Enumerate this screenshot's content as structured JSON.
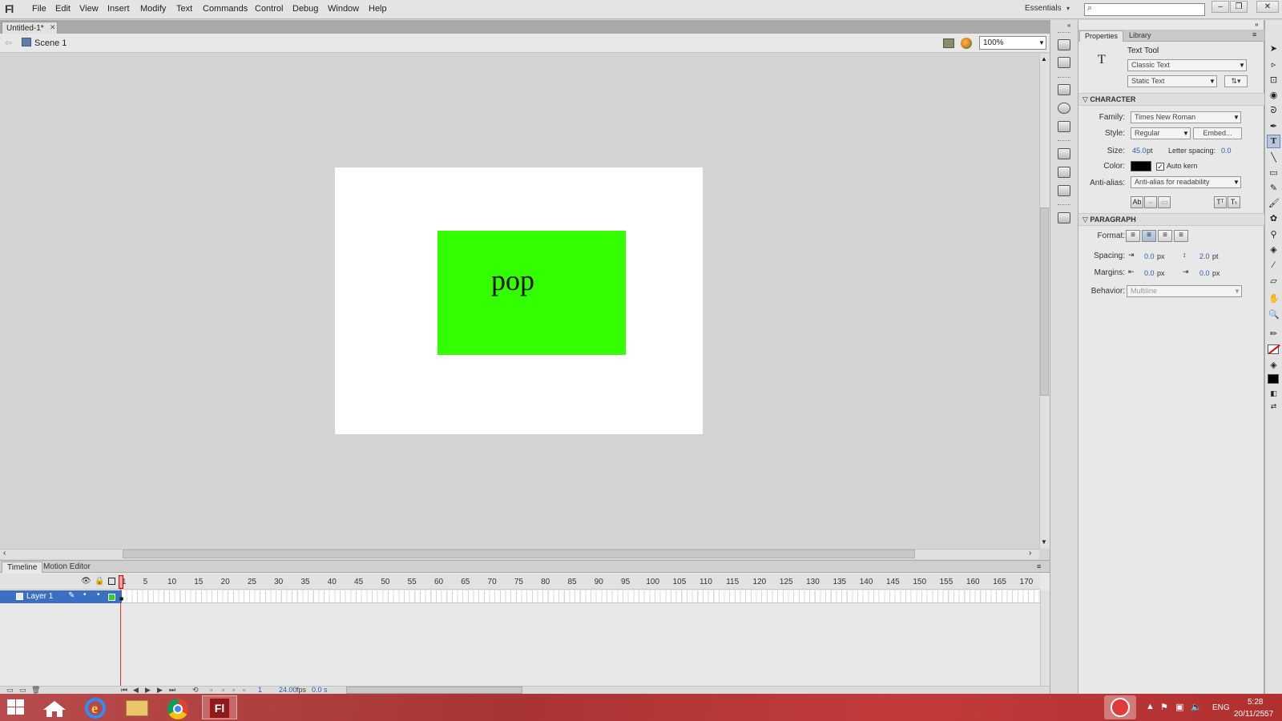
{
  "app": {
    "logo": "Fl",
    "workspace": "Essentials"
  },
  "menu": [
    "File",
    "Edit",
    "View",
    "Insert",
    "Modify",
    "Text",
    "Commands",
    "Control",
    "Debug",
    "Window",
    "Help"
  ],
  "document": {
    "tab_title": "Untitled-1*",
    "scene": "Scene 1",
    "zoom": "100%"
  },
  "stage": {
    "text": "pop",
    "background": "#ffffff",
    "rect_color": "#33ff00"
  },
  "timeline": {
    "tabs": [
      "Timeline",
      "Motion Editor"
    ],
    "frame_numbers": [
      "1",
      "5",
      "10",
      "15",
      "20",
      "25",
      "30",
      "35",
      "40",
      "45",
      "50",
      "55",
      "60",
      "65",
      "70",
      "75",
      "80",
      "85",
      "90",
      "95",
      "100",
      "105",
      "110",
      "115",
      "120",
      "125",
      "130",
      "135",
      "140",
      "145",
      "150",
      "155",
      "160",
      "165",
      "170"
    ],
    "layer_name": "Layer 1",
    "current_frame": "1",
    "fps": "24.00",
    "fps_unit": "fps",
    "time": "0.0 s"
  },
  "properties": {
    "tabs": [
      "Properties",
      "Library"
    ],
    "tool_glyph": "T",
    "tool_name": "Text Tool",
    "text_engine": "Classic Text",
    "text_type": "Static Text",
    "character": {
      "header": "CHARACTER",
      "family_label": "Family:",
      "family": "Times New Roman",
      "style_label": "Style:",
      "style": "Regular",
      "embed": "Embed...",
      "size_label": "Size:",
      "size": "45.0",
      "size_unit": "pt",
      "letter_spacing_label": "Letter spacing:",
      "letter_spacing": "0.0",
      "color_label": "Color:",
      "color": "#000000",
      "auto_kern": "Auto kern",
      "antialias_label": "Anti-alias:",
      "antialias": "Anti-alias for readability"
    },
    "paragraph": {
      "header": "PARAGRAPH",
      "format_label": "Format:",
      "spacing_label": "Spacing:",
      "indent": "0.0",
      "indent_unit": "px",
      "line_spacing": "2.0",
      "line_spacing_unit": "pt",
      "margins_label": "Margins:",
      "left_margin": "0.0",
      "left_margin_unit": "px",
      "right_margin": "0.0",
      "right_margin_unit": "px",
      "behavior_label": "Behavior:",
      "behavior": "Multiline"
    }
  },
  "taskbar": {
    "lang": "ENG",
    "time": "5:28",
    "date": "20/11/2557"
  }
}
